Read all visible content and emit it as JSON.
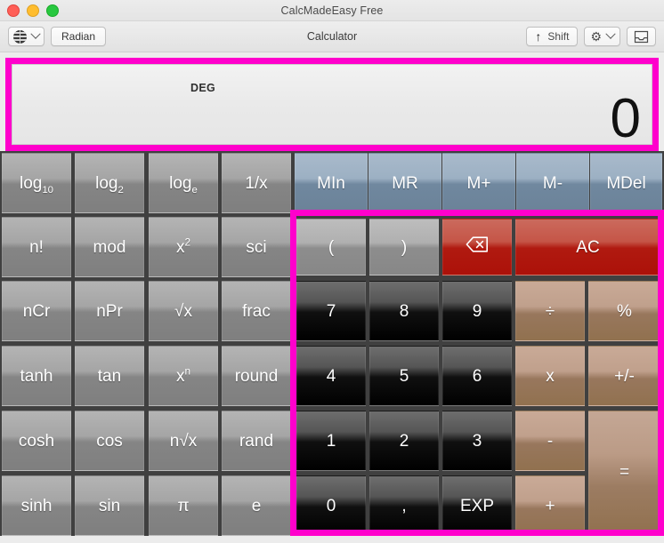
{
  "colors": {
    "highlight": "#ff00cc",
    "function_key": "#9a9a9a",
    "memory_key": "#7d93a8",
    "number_key": "#111111",
    "operator_key": "#9c7c62",
    "clear_key": "#b01a10"
  },
  "window": {
    "title": "CalcMadeEasy Free",
    "traffic_lights": [
      "close",
      "minimize",
      "maximize"
    ]
  },
  "toolbar": {
    "globe_button": "globe-icon",
    "globe_chevron": "chevron-down-icon",
    "angle_mode_label": "Radian",
    "center_title": "Calculator",
    "shift_label": "Shift",
    "shift_icon": "up-arrow-icon",
    "gear_icon": "gear-icon",
    "gear_chevron": "chevron-down-icon",
    "inbox_icon": "inbox-tray-icon"
  },
  "display": {
    "mode_label": "DEG",
    "value": "0"
  },
  "keypad": {
    "functions": [
      [
        "log",
        "10",
        "log",
        "2",
        "log",
        "e",
        "1/x"
      ],
      [
        "n!",
        "mod",
        "x",
        "2",
        "sci"
      ],
      [
        "nCr",
        "nPr",
        "√x",
        "frac"
      ],
      [
        "tanh",
        "tan",
        "x",
        "n",
        "round"
      ],
      [
        "cosh",
        "cos",
        "n√x",
        "rand"
      ],
      [
        "sinh",
        "sin",
        "π",
        "e"
      ]
    ],
    "function_labels": {
      "log10_base": "log",
      "log10_sub": "10",
      "log2_base": "log",
      "log2_sub": "2",
      "loge_base": "log",
      "loge_sub": "e",
      "inverse": "1/x",
      "factorial": "n!",
      "mod": "mod",
      "square_base": "x",
      "square_sup": "2",
      "sci": "sci",
      "ncr": "nCr",
      "npr": "nPr",
      "sqrt": "√x",
      "frac": "frac",
      "tanh": "tanh",
      "tan": "tan",
      "power_base": "x",
      "power_sup": "n",
      "round": "round",
      "cosh": "cosh",
      "cos": "cos",
      "nthroot": "n√x",
      "rand": "rand",
      "sinh": "sinh",
      "sin": "sin",
      "pi": "π",
      "e": "e"
    },
    "memory": [
      "MIn",
      "MR",
      "M+",
      "M-",
      "MDel"
    ],
    "memory_labels": {
      "min": "MIn",
      "mr": "MR",
      "mplus": "M+",
      "mminus": "M-",
      "mdel": "MDel"
    },
    "pad": {
      "open_paren": "(",
      "close_paren": ")",
      "backspace": "backspace-icon",
      "all_clear": "AC",
      "d7": "7",
      "d8": "8",
      "d9": "9",
      "divide": "÷",
      "percent": "%",
      "d4": "4",
      "d5": "5",
      "d6": "6",
      "multiply": "x",
      "plusminus": "+/-",
      "d1": "1",
      "d2": "2",
      "d3": "3",
      "minus": "-",
      "equals": "=",
      "d0": "0",
      "comma": ",",
      "exp": "EXP",
      "plus": "+"
    }
  }
}
